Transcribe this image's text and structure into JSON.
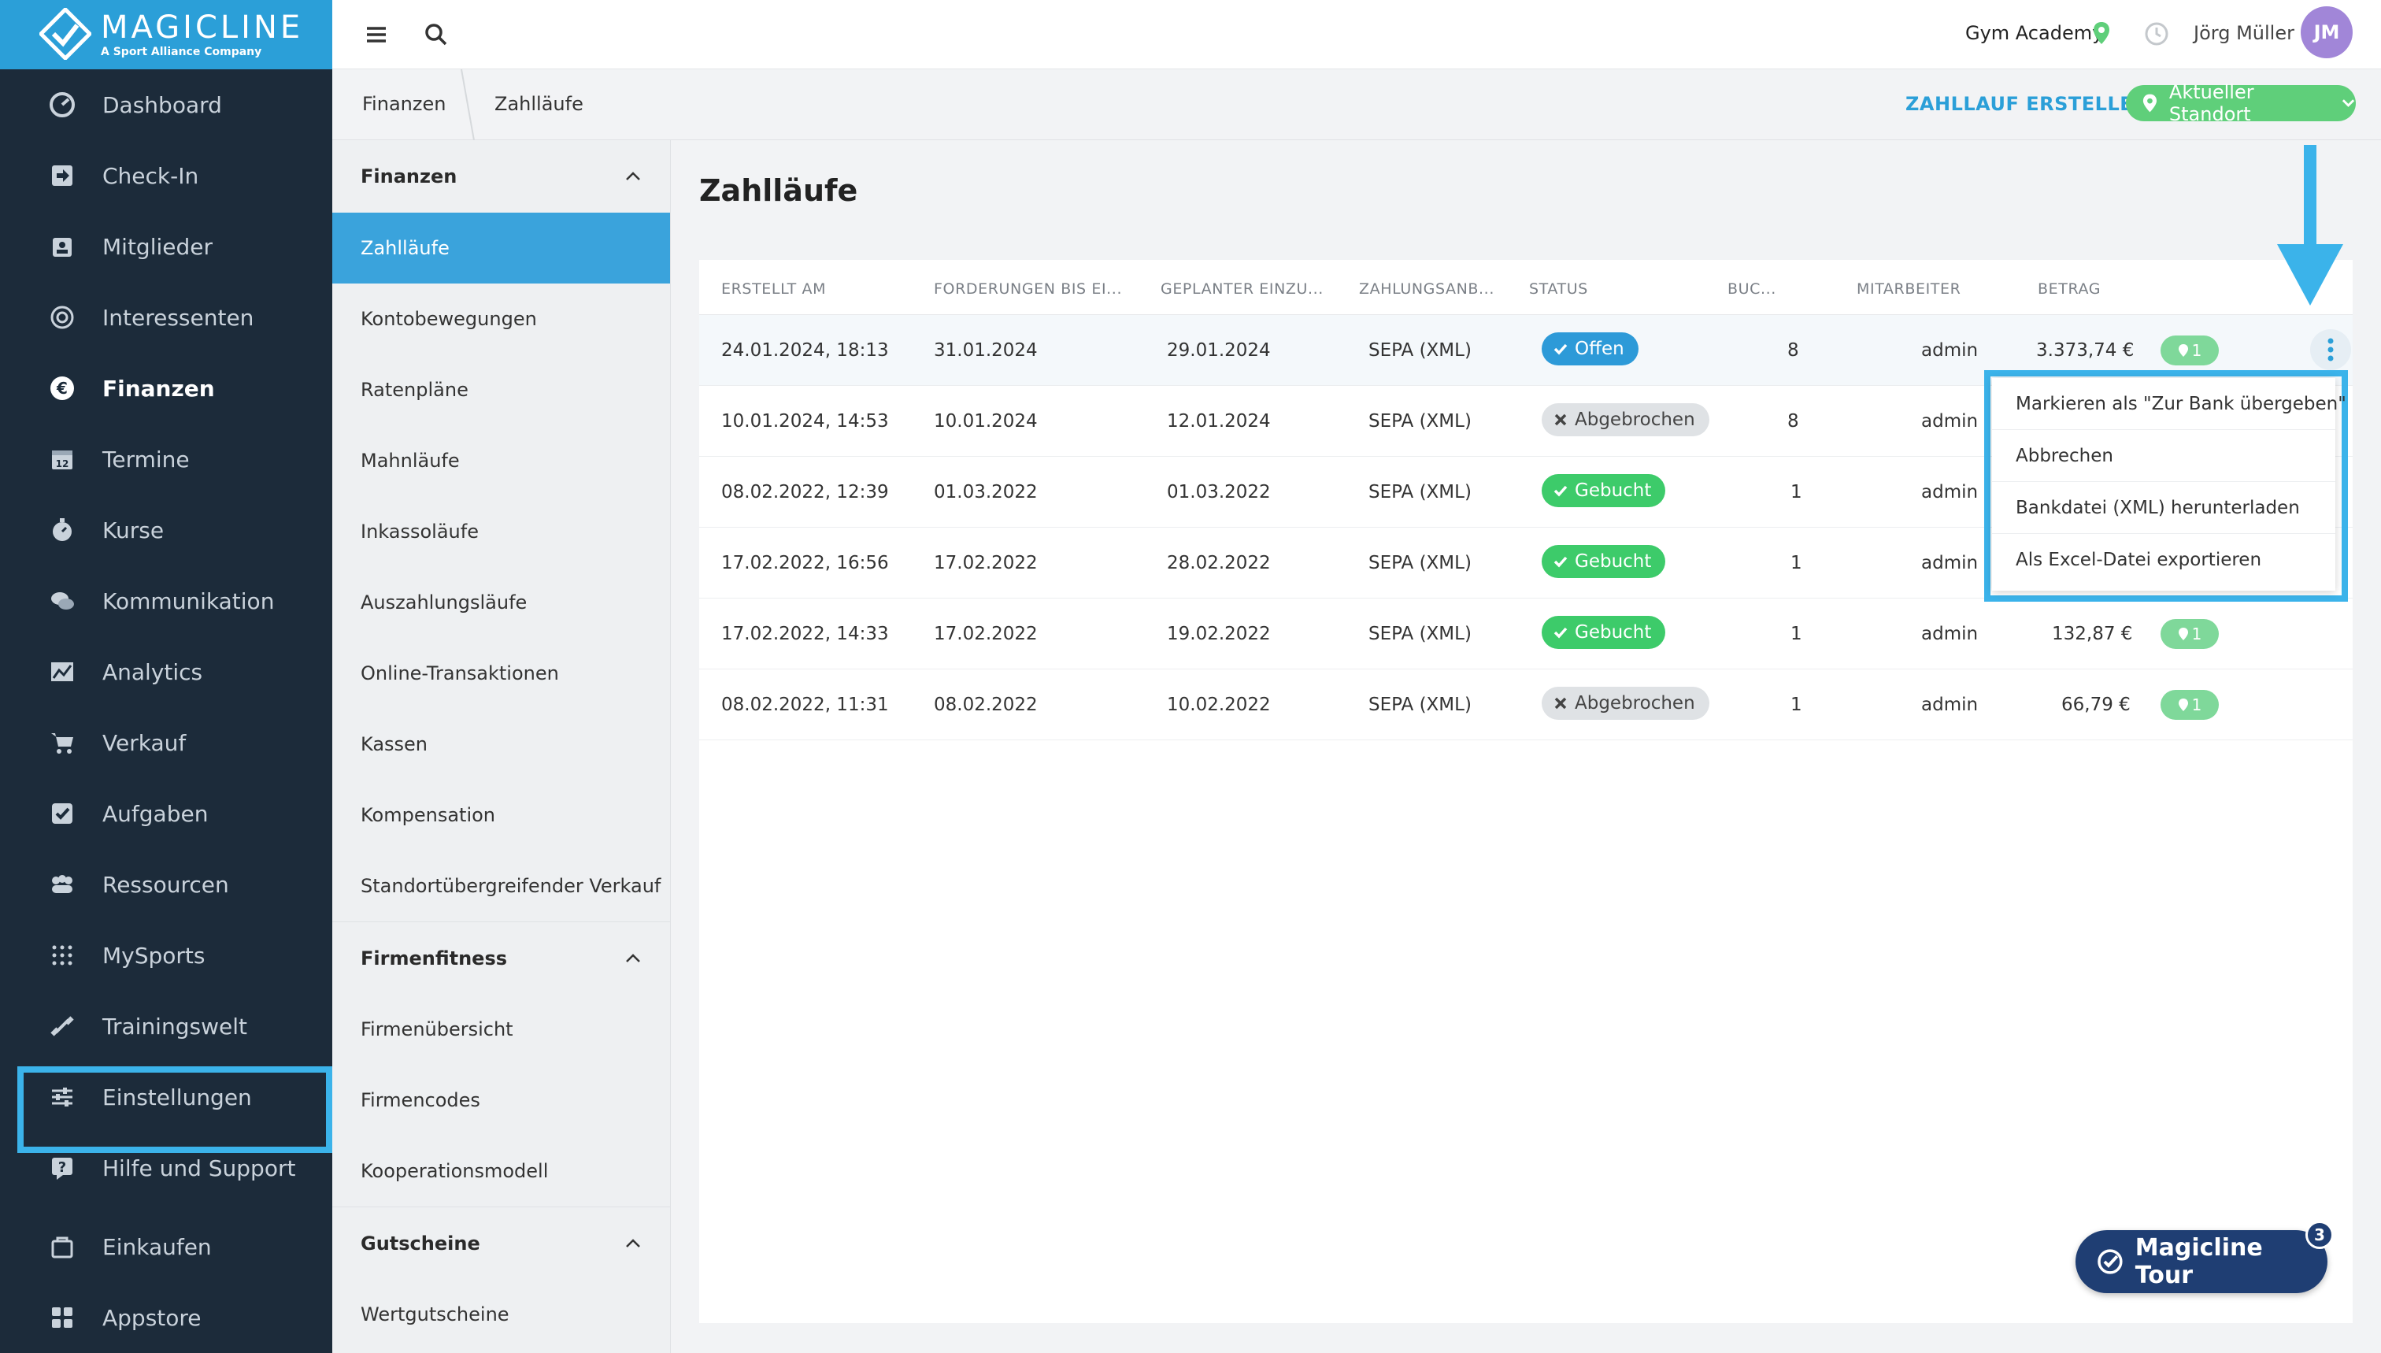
{
  "brand": {
    "name": "MAGICLINE",
    "tagline": "A Sport Alliance Company",
    "color": "#2b9fd8"
  },
  "sidebar": {
    "items": [
      {
        "label": "Dashboard",
        "icon": "dashboard-icon"
      },
      {
        "label": "Check-In",
        "icon": "check-in-icon"
      },
      {
        "label": "Mitglieder",
        "icon": "members-icon"
      },
      {
        "label": "Interessenten",
        "icon": "prospects-icon"
      },
      {
        "label": "Finanzen",
        "icon": "euro-icon",
        "active": true
      },
      {
        "label": "Termine",
        "icon": "calendar-icon"
      },
      {
        "label": "Kurse",
        "icon": "stopwatch-icon"
      },
      {
        "label": "Kommunikation",
        "icon": "chat-icon"
      },
      {
        "label": "Analytics",
        "icon": "chart-icon"
      },
      {
        "label": "Verkauf",
        "icon": "cart-icon"
      },
      {
        "label": "Aufgaben",
        "icon": "checkbox-icon"
      },
      {
        "label": "Ressourcen",
        "icon": "group-icon"
      },
      {
        "label": "MySports",
        "icon": "dots-grid-icon"
      },
      {
        "label": "Trainingswelt",
        "icon": "dumbbell-icon"
      },
      {
        "label": "Einstellungen",
        "icon": "sliders-icon",
        "highlighted": true
      },
      {
        "label": "Hilfe und Support",
        "icon": "help-icon"
      },
      {
        "label": "Einkaufen",
        "icon": "shop-icon"
      },
      {
        "label": "Appstore",
        "icon": "apps-icon"
      }
    ]
  },
  "topbar": {
    "gym": "Gym Academy",
    "user": "Jörg Müller",
    "initials": "JM"
  },
  "breadcrumb": {
    "parent": "Finanzen",
    "current": "Zahlläufe"
  },
  "actions": {
    "create": "ZAHLLAUF ERSTELLEN",
    "location": "Aktueller Standort"
  },
  "subnav": {
    "sections": [
      {
        "title": "Finanzen",
        "items": [
          "Zahlläufe",
          "Kontobewegungen",
          "Ratenpläne",
          "Mahnläufe",
          "Inkassoläufe",
          "Auszahlungsläufe",
          "Online-Transaktionen",
          "Kassen",
          "Kompensation",
          "Standortübergreifender Verkauf"
        ]
      },
      {
        "title": "Firmenfitness",
        "items": [
          "Firmenübersicht",
          "Firmencodes",
          "Kooperationsmodell"
        ]
      },
      {
        "title": "Gutscheine",
        "items": [
          "Wertgutscheine"
        ]
      }
    ]
  },
  "page": {
    "title": "Zahlläufe"
  },
  "table": {
    "columns": [
      "ERSTELLT AM",
      "FORDERUNGEN BIS EI...",
      "GEPLANTER EINZU...",
      "ZAHLUNGSANB...",
      "STATUS",
      "BUC...",
      "MITARBEITER",
      "BETRAG"
    ],
    "rows": [
      {
        "created": "24.01.2024, 18:13",
        "until": "31.01.2024",
        "planned": "29.01.2024",
        "provider": "SEPA (XML)",
        "status": "Offen",
        "bookings": "8",
        "employee": "admin",
        "amount": "3.373,74 €",
        "locations": "1"
      },
      {
        "created": "10.01.2024, 14:53",
        "until": "10.01.2024",
        "planned": "12.01.2024",
        "provider": "SEPA (XML)",
        "status": "Abgebrochen",
        "bookings": "8",
        "employee": "admin",
        "amount": "",
        "locations": ""
      },
      {
        "created": "08.02.2022, 12:39",
        "until": "01.03.2022",
        "planned": "01.03.2022",
        "provider": "SEPA (XML)",
        "status": "Gebucht",
        "bookings": "1",
        "employee": "admin",
        "amount": "",
        "locations": ""
      },
      {
        "created": "17.02.2022, 16:56",
        "until": "17.02.2022",
        "planned": "28.02.2022",
        "provider": "SEPA (XML)",
        "status": "Gebucht",
        "bookings": "1",
        "employee": "admin",
        "amount": "",
        "locations": ""
      },
      {
        "created": "17.02.2022, 14:33",
        "until": "17.02.2022",
        "planned": "19.02.2022",
        "provider": "SEPA (XML)",
        "status": "Gebucht",
        "bookings": "1",
        "employee": "admin",
        "amount": "132,87 €",
        "locations": "1"
      },
      {
        "created": "08.02.2022, 11:31",
        "until": "08.02.2022",
        "planned": "10.02.2022",
        "provider": "SEPA (XML)",
        "status": "Abgebrochen",
        "bookings": "1",
        "employee": "admin",
        "amount": "66,79 €",
        "locations": "1"
      }
    ]
  },
  "menu": {
    "items": [
      "Markieren als \"Zur Bank übergeben\"",
      "Abbrechen",
      "Bankdatei (XML) herunterladen",
      "Als Excel-Datei exportieren"
    ]
  },
  "tour": {
    "label": "Magicline Tour",
    "count": "3"
  },
  "colors": {
    "sidebar": "#1c2b3a",
    "accent": "#2b9fd8",
    "success": "#3dcb6a",
    "highlight": "#3bb3ea",
    "tour": "#1f3e73"
  }
}
